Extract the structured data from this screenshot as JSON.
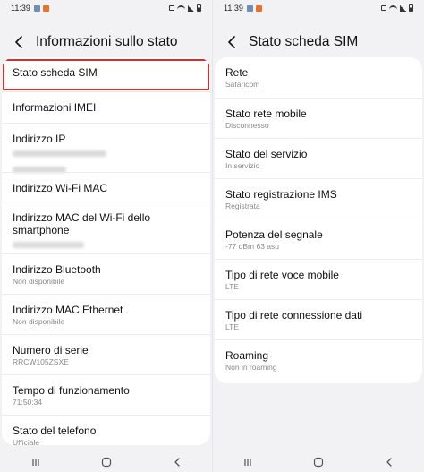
{
  "status_bar": {
    "time": "11:39"
  },
  "left_screen": {
    "title": "Informazioni sullo stato",
    "items": [
      {
        "label": "Stato scheda SIM"
      },
      {
        "label": "Informazioni IMEI"
      },
      {
        "label": "Indirizzo IP"
      },
      {
        "label": "Indirizzo Wi-Fi MAC"
      },
      {
        "label": "Indirizzo MAC del Wi-Fi dello smartphone"
      },
      {
        "label": "Indirizzo Bluetooth",
        "sub": "Non disponibile"
      },
      {
        "label": "Indirizzo MAC Ethernet",
        "sub": "Non disponibile"
      },
      {
        "label": "Numero di serie",
        "sub": "RRCW105ZSXE"
      },
      {
        "label": "Tempo di funzionamento",
        "sub": "71:50:34"
      },
      {
        "label": "Stato del telefono",
        "sub": "Ufficiale"
      }
    ]
  },
  "right_screen": {
    "title": "Stato scheda SIM",
    "items": [
      {
        "label": "Rete",
        "sub": "Safaricom"
      },
      {
        "label": "Stato rete mobile",
        "sub": "Disconnesso"
      },
      {
        "label": "Stato del servizio",
        "sub": "In servizio"
      },
      {
        "label": "Stato registrazione IMS",
        "sub": "Registrata"
      },
      {
        "label": "Potenza del segnale",
        "sub": "-77 dBm 63 asu"
      },
      {
        "label": "Tipo di rete voce mobile",
        "sub": "LTE"
      },
      {
        "label": "Tipo di rete connessione dati",
        "sub": "LTE"
      },
      {
        "label": "Roaming",
        "sub": "Non in roaming"
      }
    ]
  },
  "icons": {
    "back": "back-arrow-icon",
    "recents": "recent-apps-icon",
    "home": "home-icon",
    "nav_back": "nav-back-icon"
  },
  "colors": {
    "highlight": "#d32f2f",
    "background": "#f2f2f4",
    "card": "#ffffff"
  }
}
